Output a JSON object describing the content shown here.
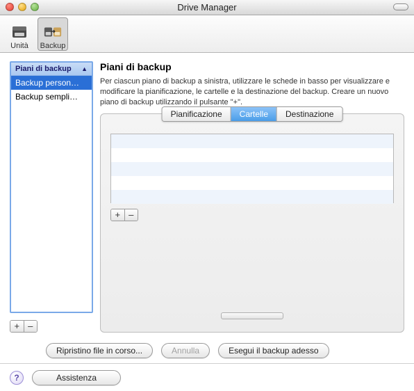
{
  "window": {
    "title": "Drive Manager"
  },
  "toolbar": {
    "drives_label": "Unità",
    "backup_label": "Backup"
  },
  "sidebar": {
    "header": "Piani di backup",
    "items": [
      {
        "label": "Backup person…",
        "selected": true
      },
      {
        "label": "Backup sempli…",
        "selected": false
      }
    ]
  },
  "content": {
    "heading": "Piani di backup",
    "description": "Per ciascun piano di backup a sinistra, utilizzare le schede in basso per visualizzare e modificare la pianificazione, le cartelle e la destinazione del backup. Creare un nuovo piano di backup utilizzando il pulsante \"+\"."
  },
  "tabs": {
    "schedule": "Pianificazione",
    "folders": "Cartelle",
    "destination": "Destinazione",
    "selected": "folders"
  },
  "buttons": {
    "restore": "Ripristino file in corso...",
    "cancel": "Annulla",
    "runBackup": "Esegui il backup adesso",
    "help": "Assistenza",
    "add": "+",
    "remove": "–"
  },
  "icons": {
    "drive": "drive-icon",
    "backup": "backup-drives-icon",
    "help": "?"
  }
}
